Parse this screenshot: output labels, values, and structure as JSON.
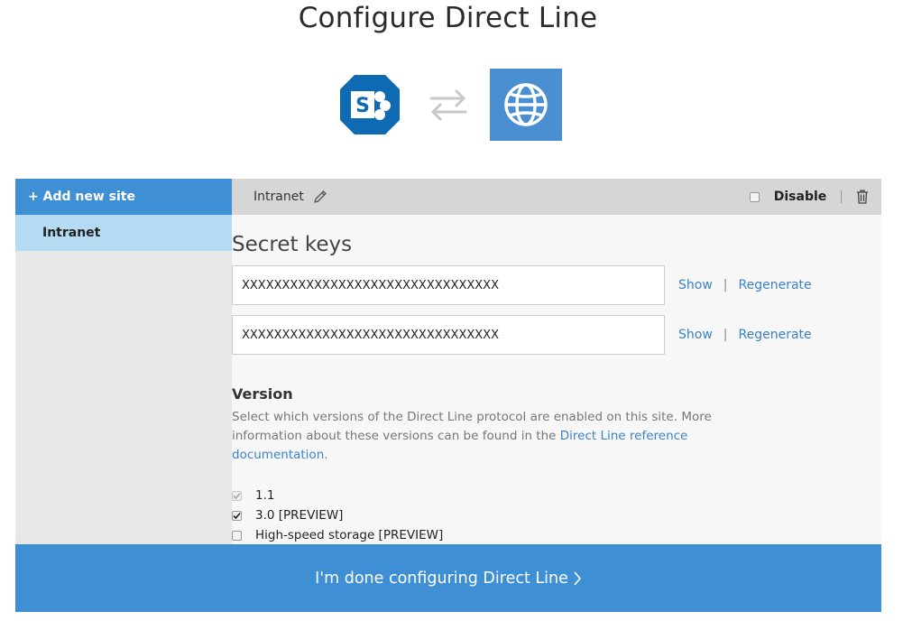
{
  "page": {
    "title": "Configure Direct Line"
  },
  "sidebar": {
    "add_label": "+ Add new site",
    "sites": [
      {
        "label": "Intranet"
      }
    ]
  },
  "site_header": {
    "name": "Intranet",
    "disable_label": "Disable",
    "disable_checked": false,
    "separator": "|"
  },
  "secret_keys": {
    "title": "Secret keys",
    "keys": [
      {
        "value": "XXXXXXXXXXXXXXXXXXXXXXXXXXXXXXXX",
        "show_label": "Show",
        "separator": "|",
        "regenerate_label": "Regenerate"
      },
      {
        "value": "XXXXXXXXXXXXXXXXXXXXXXXXXXXXXXXX",
        "show_label": "Show",
        "separator": "|",
        "regenerate_label": "Regenerate"
      }
    ]
  },
  "version": {
    "title": "Version",
    "desc_before": "Select which versions of the Direct Line protocol are enabled on this site. More information about these versions can be found in the ",
    "desc_link": "Direct Line reference documentation",
    "desc_after": ".",
    "options": [
      {
        "label": "1.1",
        "checked": true,
        "disabled": true
      },
      {
        "label": "3.0 [PREVIEW]",
        "checked": true,
        "disabled": false
      },
      {
        "label": "High-speed storage [PREVIEW]",
        "checked": false,
        "disabled": false
      }
    ]
  },
  "footer": {
    "done_label": "I'm done configuring Direct Line"
  },
  "colors": {
    "accent": "#3e8fd4",
    "selected": "#b5dbf3",
    "sharepoint": "#0f6ab4",
    "web": "#4a8fd1",
    "link": "#3a83c8"
  },
  "icons": [
    "sharepoint-icon",
    "swap-arrows-icon",
    "globe-icon",
    "pencil-icon",
    "trash-icon",
    "chevron-right-icon",
    "checkbox-icon"
  ]
}
